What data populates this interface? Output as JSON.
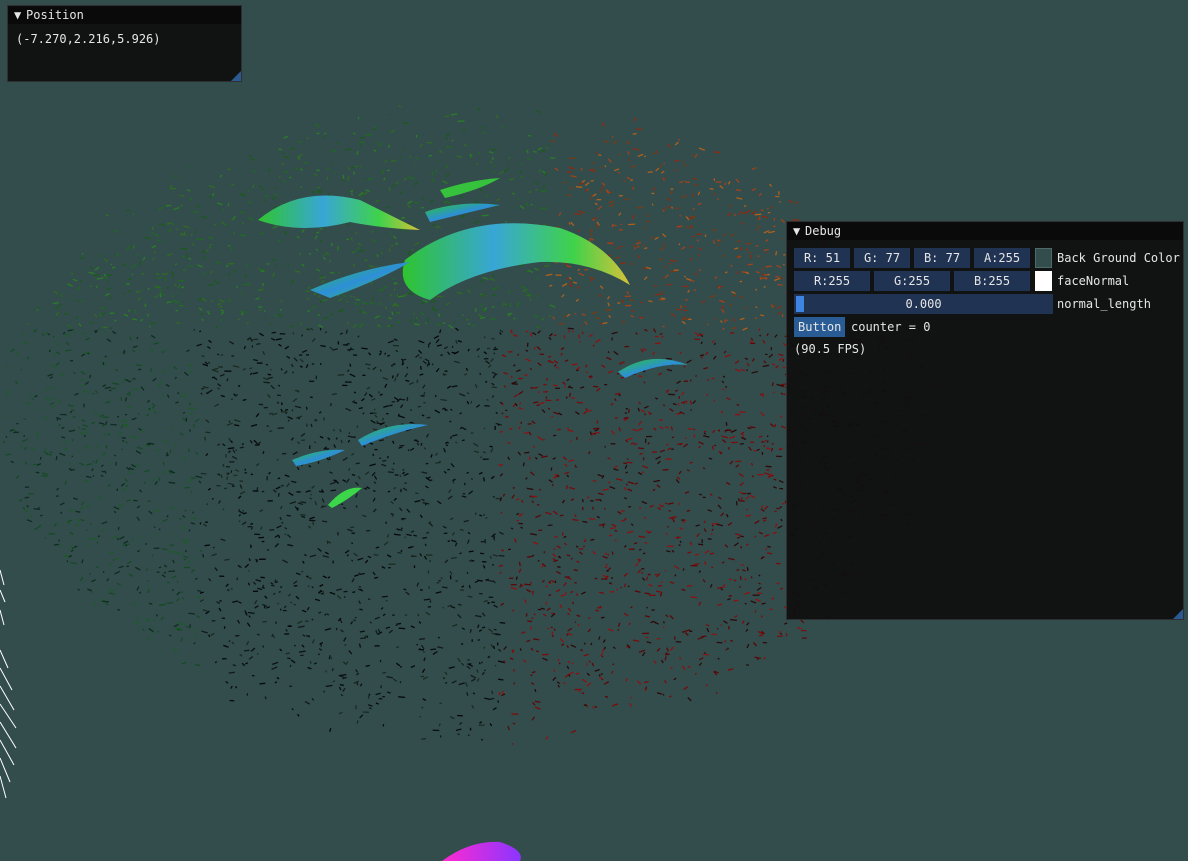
{
  "position_window": {
    "title": "Position",
    "value": "(-7.270,2.216,5.926)"
  },
  "debug_window": {
    "title": "Debug",
    "background_color": {
      "r": "R: 51",
      "g": "G: 77",
      "b": "B: 77",
      "a": "A:255",
      "label": "Back Ground Color",
      "swatch_color": "#334d4d"
    },
    "face_normal": {
      "r": "R:255",
      "g": "G:255",
      "b": "B:255",
      "label": "faceNormal",
      "swatch_color": "#ffffff"
    },
    "normal_length": {
      "value": "0.000",
      "label": "normal_length"
    },
    "button": {
      "label": "Button",
      "counter": "counter = 0"
    },
    "fps": "(90.5 FPS)"
  },
  "icons": {
    "collapse_arrow": "triangle-down-icon"
  },
  "colors": {
    "background": "#334d4d",
    "frame": "#203352",
    "button": "#295b94",
    "slider_grab": "#3d85e0"
  }
}
